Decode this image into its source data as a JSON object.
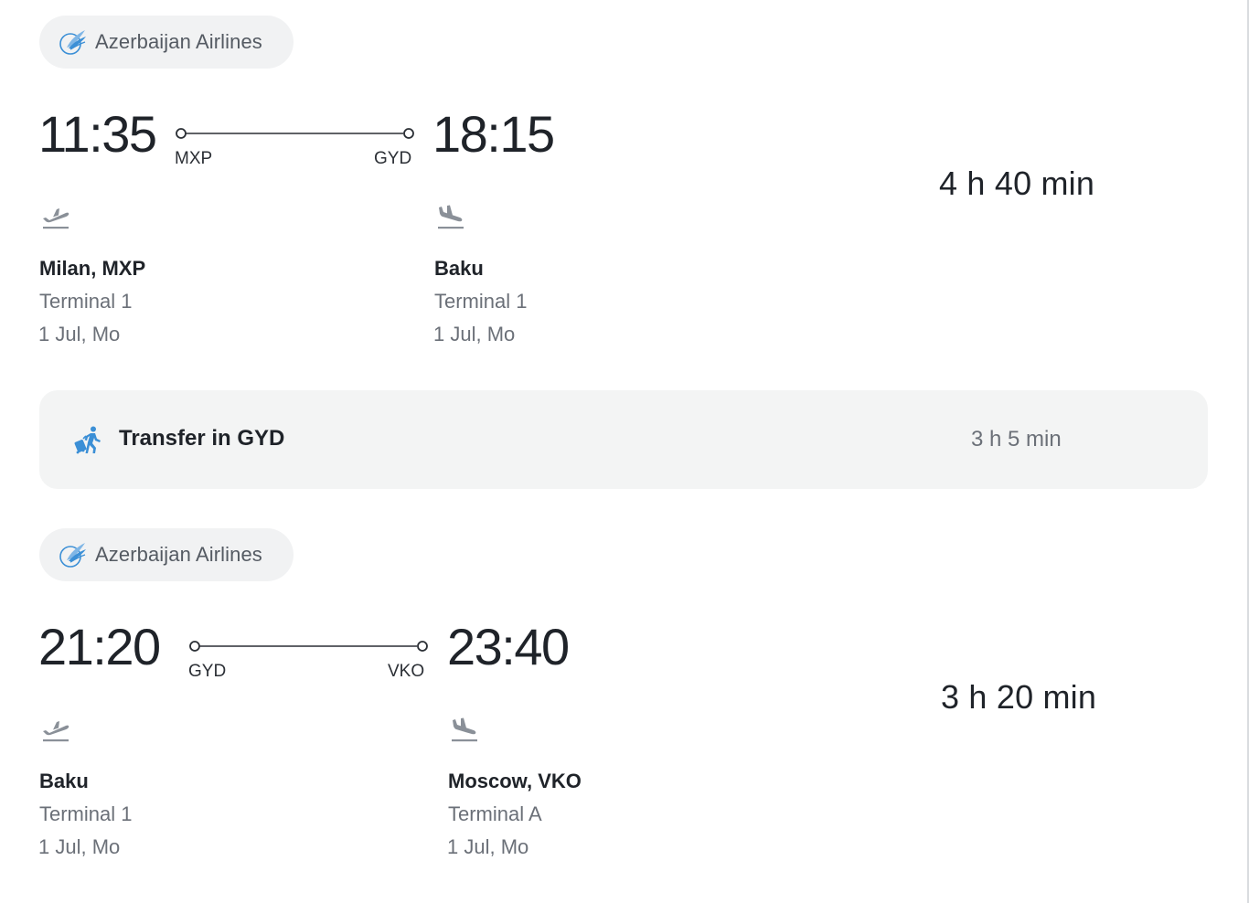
{
  "colors": {
    "accent_blue": "#3b8fd6",
    "muted_text": "#6b7078",
    "pill_background": "#f1f2f3",
    "transfer_background": "#f3f4f4"
  },
  "segments": [
    {
      "airline": "Azerbaijan Airlines",
      "airline_logo_icon": "azal-wing-logo-icon",
      "departure_time": "11:35",
      "arrival_time": "18:15",
      "from_code": "MXP",
      "to_code": "GYD",
      "duration": "4 h 40 min",
      "departure": {
        "icon": "takeoff-icon",
        "city": "Milan, MXP",
        "terminal": "Terminal 1",
        "date": "1 Jul, Mo"
      },
      "arrival": {
        "icon": "landing-icon",
        "city": "Baku",
        "terminal": "Terminal 1",
        "date": "1 Jul, Mo"
      }
    },
    {
      "airline": "Azerbaijan Airlines",
      "airline_logo_icon": "azal-wing-logo-icon",
      "departure_time": "21:20",
      "arrival_time": "23:40",
      "from_code": "GYD",
      "to_code": "VKO",
      "duration": "3 h 20 min",
      "departure": {
        "icon": "takeoff-icon",
        "city": "Baku",
        "terminal": "Terminal 1",
        "date": "1 Jul, Mo"
      },
      "arrival": {
        "icon": "landing-icon",
        "city": "Moscow, VKO",
        "terminal": "Terminal A",
        "date": "1 Jul, Mo"
      }
    }
  ],
  "transfer": {
    "icon": "walking-traveler-luggage-icon",
    "label": "Transfer in GYD",
    "duration": "3 h 5 min"
  }
}
